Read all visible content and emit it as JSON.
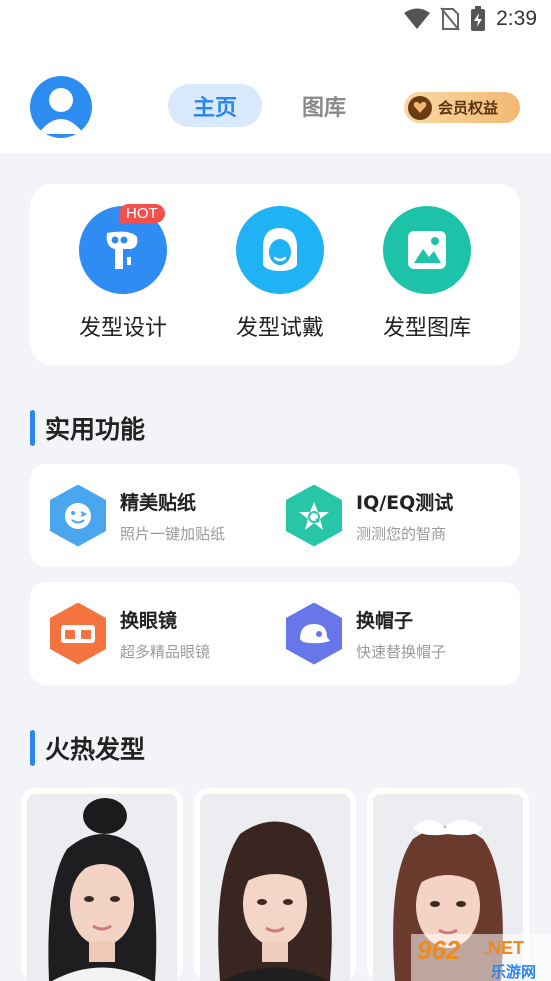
{
  "status_bar": {
    "time": "2:39"
  },
  "header": {
    "tabs": [
      {
        "label": "主页",
        "active": true
      },
      {
        "label": "图库",
        "active": false
      }
    ],
    "vip_label": "会员权益"
  },
  "features": [
    {
      "label": "发型设计",
      "icon": "hairdryer-icon",
      "color": "#2e8cf2",
      "badge": "HOT"
    },
    {
      "label": "发型试戴",
      "icon": "hair-avatar-icon",
      "color": "#1fb2f5"
    },
    {
      "label": "发型图库",
      "icon": "gallery-icon",
      "color": "#1cc3a8"
    }
  ],
  "sections": {
    "tools_title": "实用功能",
    "hot_title": "火热发型"
  },
  "tools": [
    {
      "name": "精美贴纸",
      "desc": "照片一键加贴纸",
      "icon": "sticker-icon",
      "color": "#4aa6ee"
    },
    {
      "name": "IQ/EQ测试",
      "desc": "测测您的智商",
      "icon": "star-q-icon",
      "color": "#26c6a6"
    },
    {
      "name": "换眼镜",
      "desc": "超多精品眼镜",
      "icon": "glasses-icon",
      "color": "#f5733e"
    },
    {
      "name": "换帽子",
      "desc": "快速替换帽子",
      "icon": "cap-icon",
      "color": "#6776e8"
    }
  ],
  "watermark": {
    "number": "962",
    "suffix": ".NET",
    "sub": "乐游网"
  }
}
